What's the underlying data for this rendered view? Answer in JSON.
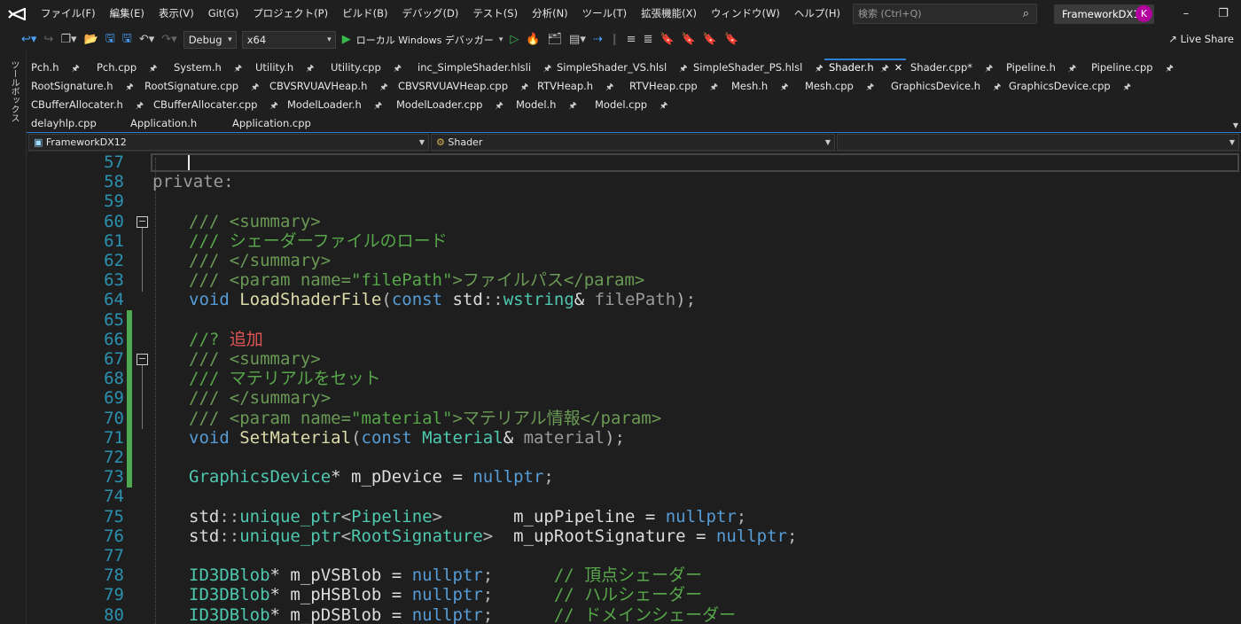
{
  "menubar": {
    "items": [
      "ファイル(F)",
      "編集(E)",
      "表示(V)",
      "Git(G)",
      "プロジェクト(P)",
      "ビルド(B)",
      "デバッグ(D)",
      "テスト(S)",
      "分析(N)",
      "ツール(T)",
      "拡張機能(X)",
      "ウィンドウ(W)",
      "ヘルプ(H)"
    ],
    "search_placeholder": "検索 (Ctrl+Q)",
    "solution_name": "FrameworkDX12",
    "avatar_initial": "K"
  },
  "toolbar": {
    "config": "Debug",
    "platform": "x64",
    "run_label": "ローカル Windows デバッガー",
    "live_share": "Live Share"
  },
  "toolbox_label": "ツールボックス",
  "tabs": [
    {
      "label": "Pch.h",
      "pinned": true
    },
    {
      "label": "Pch.cpp",
      "pinned": true
    },
    {
      "label": "System.h",
      "pinned": true
    },
    {
      "label": "Utility.h",
      "pinned": true
    },
    {
      "label": "Utility.cpp",
      "pinned": true
    },
    {
      "label": "inc_SimpleShader.hlsli",
      "pinned": true
    },
    {
      "label": "SimpleShader_VS.hlsl",
      "pinned": true
    },
    {
      "label": "SimpleShader_PS.hlsl",
      "pinned": true
    },
    {
      "label": "Shader.h",
      "pinned": true,
      "active": true
    },
    {
      "label": "Shader.cpp*",
      "pinned": true
    },
    {
      "label": "Pipeline.h",
      "pinned": true
    },
    {
      "label": "Pipeline.cpp",
      "pinned": true
    },
    {
      "label": "RootSignature.h",
      "pinned": true
    },
    {
      "label": "RootSignature.cpp",
      "pinned": true
    },
    {
      "label": "CBVSRVUAVHeap.h",
      "pinned": true
    },
    {
      "label": "CBVSRVUAVHeap.cpp",
      "pinned": true
    },
    {
      "label": "RTVHeap.h",
      "pinned": true
    },
    {
      "label": "RTVHeap.cpp",
      "pinned": true
    },
    {
      "label": "Mesh.h",
      "pinned": true
    },
    {
      "label": "Mesh.cpp",
      "pinned": true
    },
    {
      "label": "GraphicsDevice.h",
      "pinned": true
    },
    {
      "label": "GraphicsDevice.cpp",
      "pinned": true
    },
    {
      "label": "CBufferAllocater.h",
      "pinned": true
    },
    {
      "label": "CBufferAllocater.cpp",
      "pinned": true
    },
    {
      "label": "ModelLoader.h",
      "pinned": true
    },
    {
      "label": "ModelLoader.cpp",
      "pinned": true
    },
    {
      "label": "Model.h",
      "pinned": true
    },
    {
      "label": "Model.cpp",
      "pinned": true
    },
    {
      "label": "delayhlp.cpp",
      "pinned": false
    },
    {
      "label": "Application.h",
      "pinned": false
    },
    {
      "label": "Application.cpp",
      "pinned": false
    }
  ],
  "navbar": {
    "project": "FrameworkDX12",
    "scope": "Shader",
    "member": ""
  },
  "editor": {
    "line_numbers": [
      "57",
      "58",
      "59",
      "60",
      "61",
      "62",
      "63",
      "64",
      "65",
      "66",
      "67",
      "68",
      "69",
      "70",
      "71",
      "72",
      "73",
      "74",
      "75",
      "76",
      "77",
      "78",
      "79",
      "80"
    ],
    "code": {
      "l58": "private:",
      "l60": "/// <summary>",
      "l61": "/// シェーダーファイルのロード",
      "l62": "/// </summary>",
      "l63a": "/// <param name=",
      "l63b": "\"filePath\"",
      "l63c": ">ファイルパス</param>",
      "l64_void": "void",
      "l64_fn": "LoadShaderFile",
      "l64_const": "const",
      "l64_std": "std",
      "l64_type": "wstring",
      "l64_param": "filePath",
      "l66a": "//?",
      "l66b": "追加",
      "l67": "/// <summary>",
      "l68": "/// マテリアルをセット",
      "l69": "/// </summary>",
      "l70a": "/// <param name=",
      "l70b": "\"material\"",
      "l70c": ">マテリアル情報</param>",
      "l71_void": "void",
      "l71_fn": "SetMaterial",
      "l71_const": "const",
      "l71_type": "Material",
      "l71_param": "material",
      "l73_type": "GraphicsDevice",
      "l73_var": "m_pDevice",
      "nullptr": "nullptr",
      "l75_type": "Pipeline",
      "l75_var": "m_upPipeline",
      "l76_type": "RootSignature",
      "l76_var": "m_upRootSignature",
      "uptr": "unique_ptr",
      "blob": "ID3DBlob",
      "l78_var": "m_pVSBlob",
      "l78_cm": "// 頂点シェーダー",
      "l79_var": "m_pHSBlob",
      "l79_cm": "// ハルシェーダー",
      "l80_var": "m_pDSBlob",
      "l80_cm": "// ドメインシェーダー"
    }
  }
}
